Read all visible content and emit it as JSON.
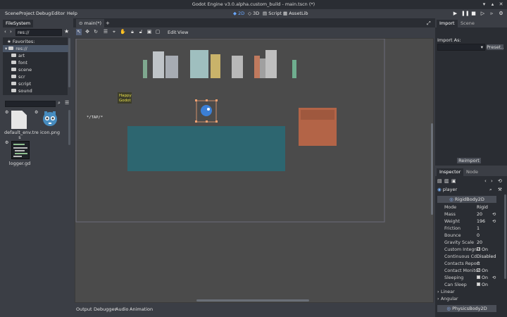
{
  "window": {
    "title": "Godot Engine v3.0.alpha.custom_build - main.tscn (*)"
  },
  "menu": {
    "items": [
      "Scene",
      "Project",
      "Debug",
      "Editor",
      "Help"
    ]
  },
  "workspaces": {
    "items": [
      "2D",
      "3D",
      "Script",
      "AssetLib"
    ],
    "active": "2D"
  },
  "filesystem": {
    "tab": "FileSystem",
    "path": "res://",
    "favorites": "Favorites:",
    "root": "res://",
    "folders": [
      "art",
      "font",
      "scene",
      "scr",
      "script",
      "sound"
    ],
    "files": [
      {
        "name": "default_env.tres",
        "label1": "default_env.tre",
        "label2": "s"
      },
      {
        "name": "icon.png",
        "label1": "icon.png"
      },
      {
        "name": "logger.gd",
        "label1": "logger.gd"
      }
    ]
  },
  "scene_tab": {
    "label": "main(*)"
  },
  "canvas_menu": {
    "items": [
      "Edit",
      "View"
    ]
  },
  "viewport": {
    "label_happy": "Happy",
    "label_godot": "Godot",
    "tap_text": "*/TAP/*",
    "colors": {
      "water": "#2d6670",
      "rock": "#b36447",
      "bg": "#4b4b4b"
    }
  },
  "bottom_panel": {
    "items": [
      "Output",
      "Debugger",
      "Audio",
      "Animation"
    ]
  },
  "import_dock": {
    "tabs": [
      "Import",
      "Scene"
    ],
    "import_as": "Import As:",
    "preset": "Preset..",
    "reimport": "Reimport"
  },
  "inspector": {
    "tabs": [
      "Inspector",
      "Node"
    ],
    "node_name": "player",
    "class_header": "RigidBody2D",
    "properties": [
      {
        "name": "Mode",
        "value": "Rigid"
      },
      {
        "name": "Mass",
        "value": "20"
      },
      {
        "name": "Weight",
        "value": "196"
      },
      {
        "name": "Friction",
        "value": "1"
      },
      {
        "name": "Bounce",
        "value": "0"
      },
      {
        "name": "Gravity Scale",
        "value": "20"
      },
      {
        "name": "Custom Integrat",
        "value": "On"
      },
      {
        "name": "Continuous Cd",
        "value": "Disabled"
      },
      {
        "name": "Contacts Report",
        "value": "0"
      },
      {
        "name": "Contact Monitor",
        "value": "On"
      },
      {
        "name": "Sleeping",
        "value": "On"
      },
      {
        "name": "Can Sleep",
        "value": "On"
      }
    ],
    "sections": [
      "Linear",
      "Angular"
    ],
    "footer_class": "PhysicsBody2D"
  }
}
